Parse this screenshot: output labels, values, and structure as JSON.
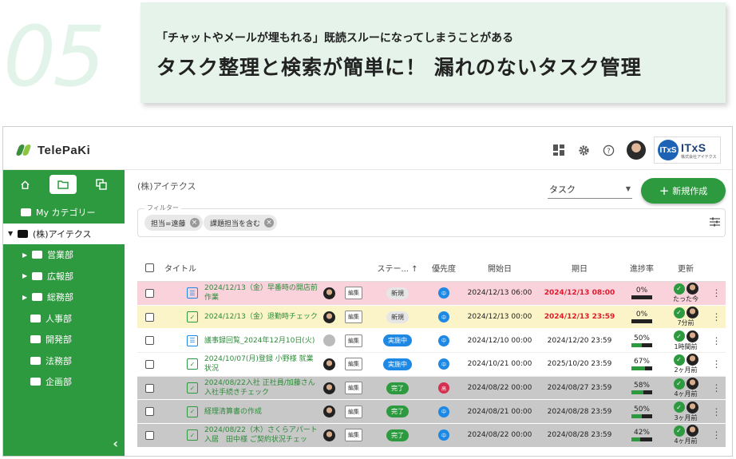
{
  "hero": {
    "number": "05",
    "subtitle": "「チャットやメールが埋もれる」既読スルーになってしまうことがある",
    "title": "タスク整理と検索が簡単に！ 漏れのないタスク管理"
  },
  "app": {
    "logo": "TelePaKi",
    "brand": {
      "mark": "ITxS",
      "name": "ITxS",
      "sub": "株式会社アイテクス"
    }
  },
  "sidebar": {
    "items": [
      {
        "label": "My カテゴリー"
      },
      {
        "label": "(株)アイテクス"
      },
      {
        "label": "営業部"
      },
      {
        "label": "広報部"
      },
      {
        "label": "総務部"
      },
      {
        "label": "人事部"
      },
      {
        "label": "開発部"
      },
      {
        "label": "法務部"
      },
      {
        "label": "企画部"
      }
    ]
  },
  "main": {
    "breadcrumb": "(株)アイテクス",
    "view_select": "タスク",
    "new_button": "新規作成",
    "filter_label": "フィルター",
    "chips": [
      "担当=遠藤",
      "課題担当を含む"
    ]
  },
  "table": {
    "headers": {
      "title": "タイトル",
      "status": "ステー... ↑",
      "priority": "優先度",
      "start": "開始日",
      "due": "期日",
      "progress": "進捗率",
      "updated": "更新"
    },
    "edit_label": "編集",
    "rows": [
      {
        "title": "2024/12/13（金）早番時の開店前作業",
        "status": "新規",
        "priority": "中",
        "start": "2024/12/13 06:00",
        "due": "2024/12/13 08:00",
        "progress": "0%",
        "updated": "たった今"
      },
      {
        "title": "2024/12/13（金）退勤時チェック",
        "status": "新規",
        "priority": "中",
        "start": "2024/12/13 00:00",
        "due": "2024/12/13 23:59",
        "progress": "0%",
        "updated": "7分前"
      },
      {
        "title": "議事録回覧_2024年12月10日(火)",
        "status": "実施中",
        "priority": "中",
        "start": "2024/12/10 00:00",
        "due": "2024/12/20 23:59",
        "progress": "50%",
        "updated": "1時間前"
      },
      {
        "title": "2024/10/07(月)登録 小野様 就業状況",
        "status": "実施中",
        "priority": "中",
        "start": "2024/10/21 00:00",
        "due": "2025/10/20 23:59",
        "progress": "67%",
        "updated": "2ヶ月前"
      },
      {
        "title": "2024/08/22入社 正社員/加藤さん入社手続きチェック",
        "status": "完了",
        "priority": "高",
        "start": "2024/08/22 00:00",
        "due": "2024/08/27 23:59",
        "progress": "58%",
        "updated": "4ヶ月前"
      },
      {
        "title": "経理清算書の作成",
        "status": "完了",
        "priority": "中",
        "start": "2024/08/21 00:00",
        "due": "2024/08/28 23:59",
        "progress": "50%",
        "updated": "3ヶ月前"
      },
      {
        "title": "2024/08/22（木）さくらアパート入居　田中様 ご契約状況チェッ",
        "status": "完了",
        "priority": "中",
        "start": "2024/08/22 00:00",
        "due": "2024/08/28 23:59",
        "progress": "42%",
        "updated": "4ヶ月前"
      }
    ]
  }
}
